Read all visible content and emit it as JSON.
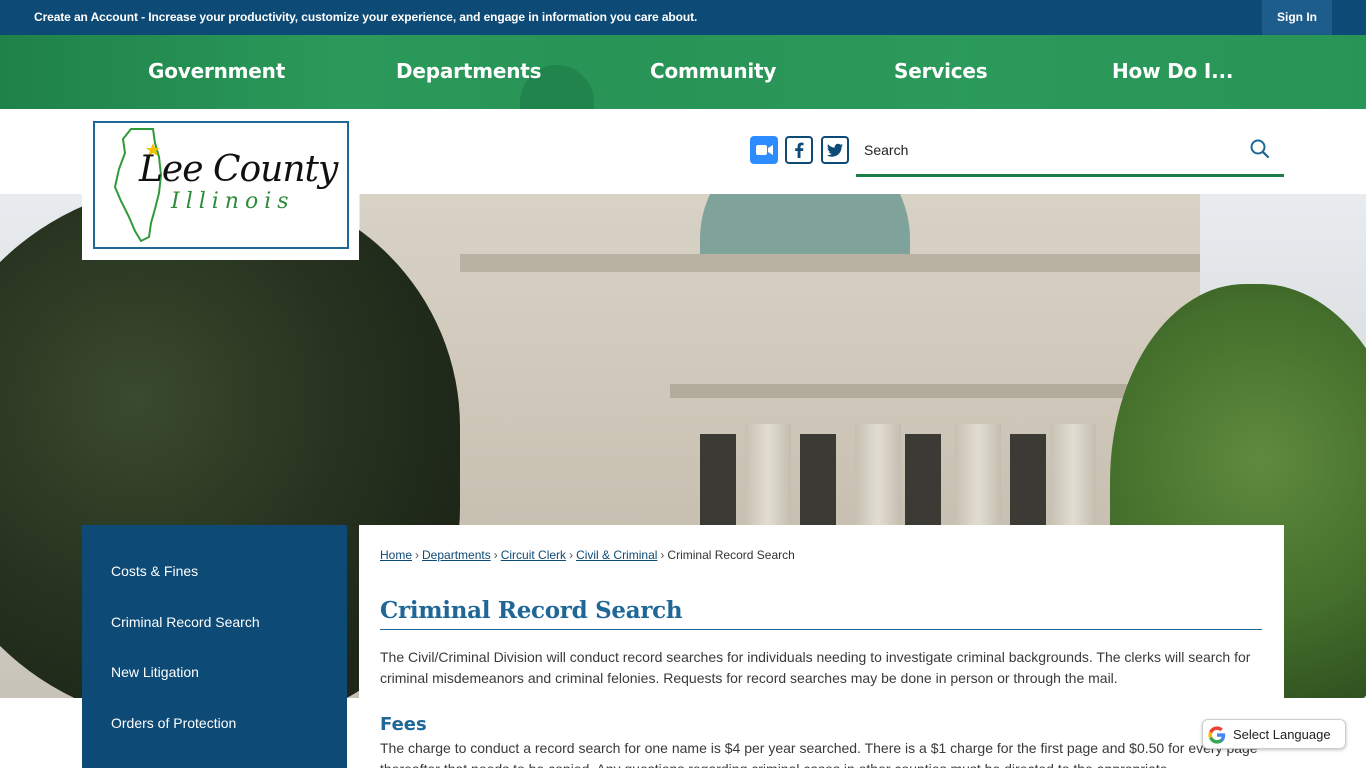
{
  "topbar": {
    "create_account": "Create an Account",
    "message": " - Increase your productivity, customize your experience, and engage in information you care about.",
    "sign_in": "Sign In"
  },
  "nav": {
    "items": [
      "Government",
      "Departments",
      "Community",
      "Services",
      "How Do I..."
    ]
  },
  "logo": {
    "title": "Lee County",
    "subtitle": "Illinois"
  },
  "social": {
    "icons": [
      "zoom-icon",
      "facebook-icon",
      "twitter-icon"
    ]
  },
  "search": {
    "placeholder": "Search"
  },
  "sidebar": {
    "items": [
      "Costs & Fines",
      "Criminal Record Search",
      "New Litigation",
      "Orders of Protection"
    ]
  },
  "breadcrumb": {
    "links": [
      "Home",
      "Departments",
      "Circuit Clerk",
      "Civil & Criminal"
    ],
    "separator": "›",
    "current": "Criminal Record Search"
  },
  "content": {
    "title": "Criminal Record Search",
    "intro": "The Civil/Criminal Division will conduct record searches for individuals needing to investigate criminal backgrounds. The clerks will search for criminal misdemeanors and criminal felonies. Requests for record searches may be done in person or through the mail.",
    "fees_heading": "Fees",
    "fees_text": "The charge to conduct a record search for one name is $4 per year searched. There is a $1 charge for the first page and $0.50 for every page thereafter that needs to be copied. Any questions regarding criminal cases in other counties must be directed to the appropriate"
  },
  "translate": {
    "label": "Select Language"
  },
  "colors": {
    "topbar": "#0d4a76",
    "nav": "#2b9a5a",
    "accent_blue": "#1f6796",
    "search_underline": "#1e7e47"
  }
}
